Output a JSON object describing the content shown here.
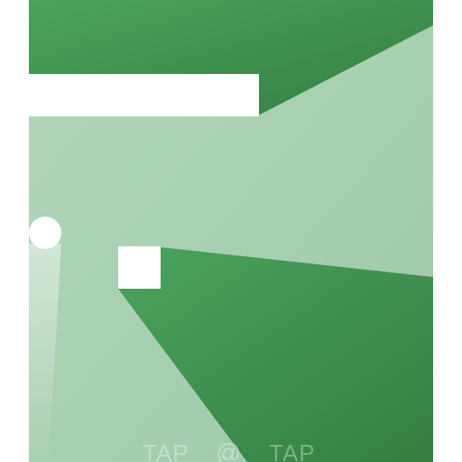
{
  "game": {
    "colors": {
      "background": "#ffffff",
      "field_dark": "#3f9150",
      "field_light": "#a9d0b2",
      "wall": "#ffffff",
      "ball": "#ffffff"
    },
    "hint": {
      "left_label": "TAP",
      "icon": "@",
      "right_label": "TAP"
    }
  }
}
